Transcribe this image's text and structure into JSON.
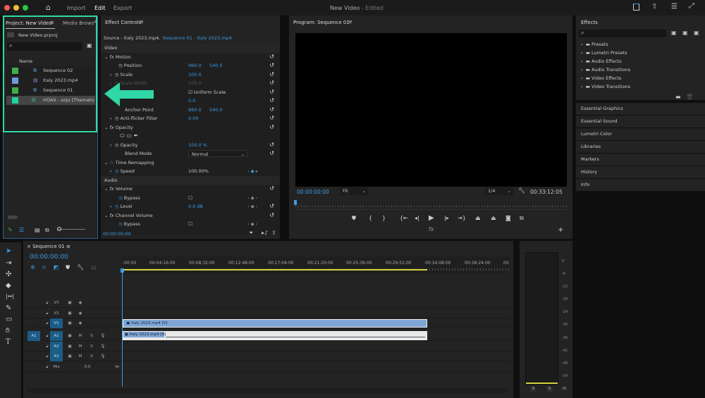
{
  "titlebar": {
    "title": "New Video",
    "status": "- Edited",
    "menu": [
      "Import",
      "Edit",
      "Export"
    ],
    "active_menu": "Edit"
  },
  "project": {
    "tab": "Project: New Video",
    "tab2": "Media Browse",
    "file": "New Video.prproj",
    "col_name": "Name",
    "items": [
      {
        "name": "Sequence 02",
        "color": "#3fae4a",
        "type": "sequence"
      },
      {
        "name": "Italy 2023.mp4",
        "color": "#6f98d8",
        "type": "video"
      },
      {
        "name": "Sequence 01",
        "color": "#3fae4a",
        "type": "sequence"
      },
      {
        "name": "HOAX - soju [Thematic].m",
        "color": "#23d1a0",
        "type": "audio",
        "selected": true
      }
    ]
  },
  "effect_controls": {
    "tab": "Effect Controls",
    "source": "Source - Italy 2023.mp4",
    "sequence": "Sequence 01 - Italy 2023.mp4",
    "video_label": "Video",
    "audio_label": "Audio",
    "motion": "Motion",
    "position": "Position",
    "pos_x": "960.0",
    "pos_y": "540.0",
    "scale": "Scale",
    "scale_val": "100.0",
    "scale_width": "Scale Width",
    "scale_width_val": "100.0",
    "uniform_scale": "Uniform Scale",
    "rotation_val": "0.0",
    "anchor": "Anchor Point",
    "anchor_x": "960.0",
    "anchor_y": "540.0",
    "antiflicker": "Anti-flicker Filter",
    "antiflicker_val": "0.00",
    "opacity": "Opacity",
    "opacity_param": "Opacity",
    "opacity_val": "100.0 %",
    "blend": "Blend Mode",
    "blend_val": "Normal",
    "time_remap": "Time Remapping",
    "speed": "Speed",
    "speed_val": "100.00%",
    "volume": "Volume",
    "bypass": "Bypass",
    "level": "Level",
    "level_val": "0.0 dB",
    "channel_volume": "Channel Volume",
    "bypass2": "Bypass",
    "timecode": "00:00:00:00"
  },
  "program": {
    "tab": "Program: Sequence 01",
    "timecode": "00:00:00:00",
    "zoom": "Fit",
    "resolution": "1/4",
    "duration": "00:33:12:05",
    "playhead_fraction": 0
  },
  "effects": {
    "tab": "Effects",
    "folders": [
      "Presets",
      "Lumetri Presets",
      "Audio Effects",
      "Audio Transitions",
      "Video Effects",
      "Video Transitions"
    ],
    "panels": [
      "Essential Graphics",
      "Essential Sound",
      "Lumetri Color",
      "Libraries",
      "Markers",
      "History",
      "Info"
    ]
  },
  "timeline": {
    "tab": "Sequence 01",
    "timecode": "00:00:00:00",
    "ruler": [
      ":00:00",
      "00:04:16:00",
      "00:08:32:00",
      "00:12:48:00",
      "00:17:04:00",
      "00:21:20:00",
      "00:25:36:00",
      "00:29:52:00",
      "00:34:08:00",
      "00:38:24:00",
      "00"
    ],
    "video_tracks": [
      "V3",
      "V2",
      "V1"
    ],
    "audio_tracks": [
      "A1",
      "A2",
      "A3"
    ],
    "source_patch": "A1",
    "mix": "Mix",
    "mix_val": "0.0",
    "clip_video": "Italy 2023.mp4 [V]",
    "clip_audio": "Italy 2023.mp4 [A]",
    "m": "M",
    "s": "S"
  },
  "meter": {
    "scale": [
      "0",
      "-6",
      "-12",
      "-18",
      "-24",
      "-30",
      "-36",
      "-42",
      "-48",
      "-54",
      "dB"
    ],
    "solo": [
      "S",
      "S"
    ]
  },
  "colors": {
    "accent": "#3c9ce6",
    "highlight": "#2fd8a6",
    "clip_video": "#7fa6d6",
    "work_area": "#d6d23a"
  }
}
